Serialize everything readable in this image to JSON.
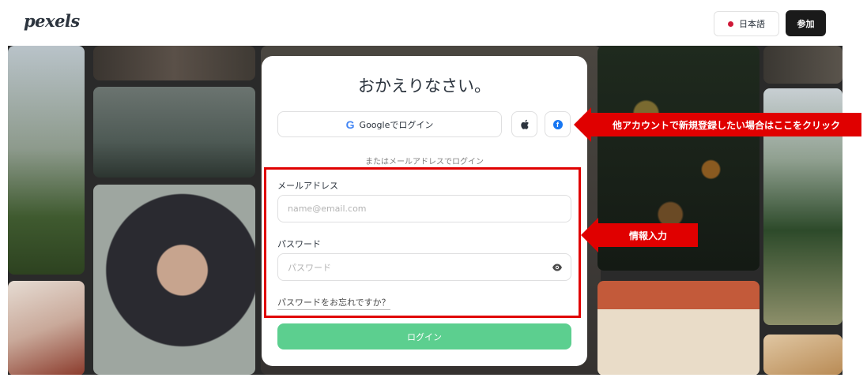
{
  "header": {
    "logo": "pexels",
    "language_label": "日本語",
    "join_label": "参加"
  },
  "modal": {
    "title": "おかえりなさい。",
    "google_label": "Googleでログイン",
    "or_text": "またはメールアドレスでログイン",
    "email_label": "メールアドレス",
    "email_placeholder": "name@email.com",
    "password_label": "パスワード",
    "password_placeholder": "パスワード",
    "forgot_label": "パスワードをお忘れですか？",
    "login_label": "ログイン"
  },
  "annotations": {
    "social_note": "他アカウントで新規登録したい場合はここをクリック",
    "input_note": "情報入力"
  },
  "colors": {
    "annotation_red": "#e00000",
    "login_green": "#5ccf8f",
    "facebook_blue": "#1877f2"
  },
  "icons": [
    "google-icon",
    "apple-icon",
    "facebook-icon",
    "eye-icon",
    "japan-flag-dot"
  ]
}
